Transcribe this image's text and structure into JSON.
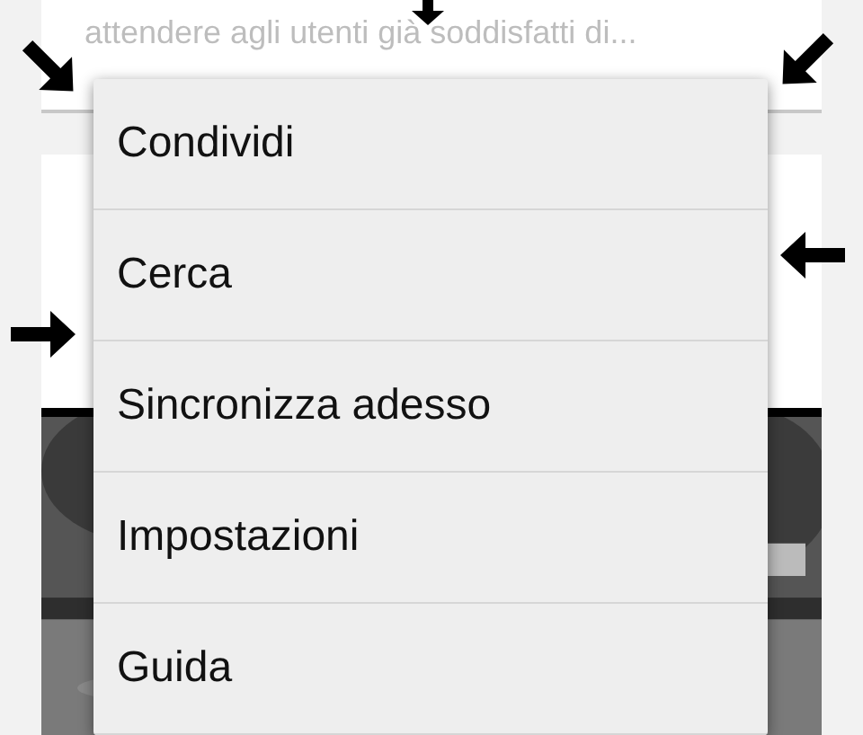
{
  "background_card": {
    "text": "attendere agli utenti già soddisfatti di..."
  },
  "menu": {
    "items": [
      {
        "label": "Condividi"
      },
      {
        "label": "Cerca"
      },
      {
        "label": "Sincronizza adesso"
      },
      {
        "label": "Impostazioni"
      },
      {
        "label": "Guida"
      }
    ]
  }
}
